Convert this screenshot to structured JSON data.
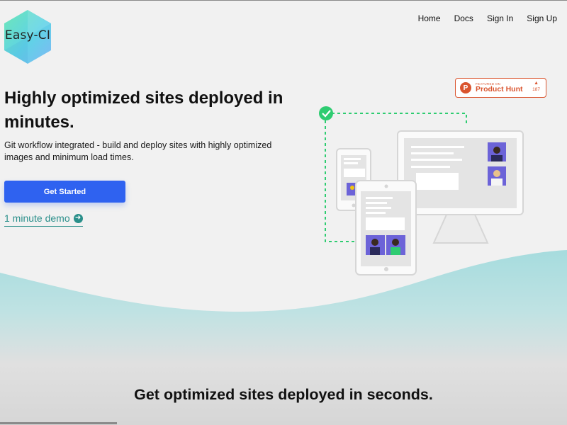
{
  "logo": {
    "text": "Easy-CI"
  },
  "nav": {
    "items": [
      {
        "label": "Home"
      },
      {
        "label": "Docs"
      },
      {
        "label": "Sign In"
      },
      {
        "label": "Sign Up"
      }
    ]
  },
  "hero": {
    "headline": "Highly optimized sites deployed in minutes.",
    "subtext": "Git workflow integrated - build and deploy sites with highly optimized images and minimum load times.",
    "cta_label": "Get Started",
    "demo_label": "1 minute demo",
    "demo_icon": "arrow-right-circle-icon"
  },
  "badge": {
    "letter": "P",
    "featured": "FEATURED ON",
    "name": "Product Hunt",
    "arrow": "▲",
    "votes": "187"
  },
  "section": {
    "title": "Get optimized sites deployed in seconds."
  },
  "colors": {
    "accent": "#2f62f0",
    "teal": "#2a8f8a",
    "wave": "#a6dcde",
    "producthunt": "#da552f",
    "check": "#2ecc71"
  }
}
